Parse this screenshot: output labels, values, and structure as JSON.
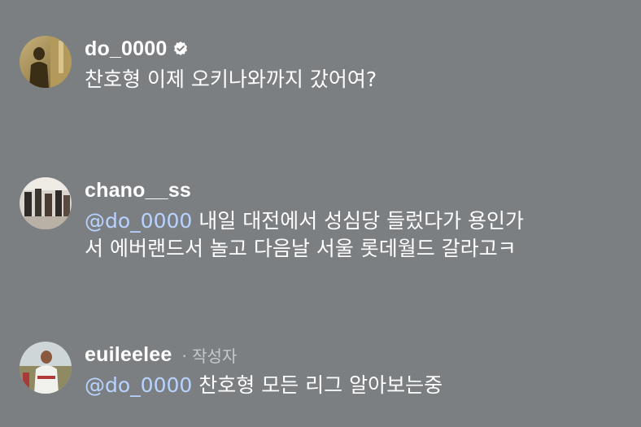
{
  "comments": [
    {
      "username": "do_0000",
      "verified": true,
      "text": "찬호형 이제 오키나와까지 갔어여?"
    },
    {
      "username": "chano__ss",
      "mention": "@do_0000",
      "text_line1": "내일 대전에서 성심당 들렀다가 용인가",
      "text_line2": "서 에버랜드서 놀고 다음날 서울 롯데월드 갈라고ㅋ"
    },
    {
      "username": "euileelee",
      "author_tag": "· 작성자",
      "mention": "@do_0000",
      "text": "찬호형 모든 리그 알아보는중"
    }
  ],
  "colors": {
    "background": "#7b7f82",
    "mention": "#b9d3ff",
    "secondary_text": "#c7c9cb"
  }
}
